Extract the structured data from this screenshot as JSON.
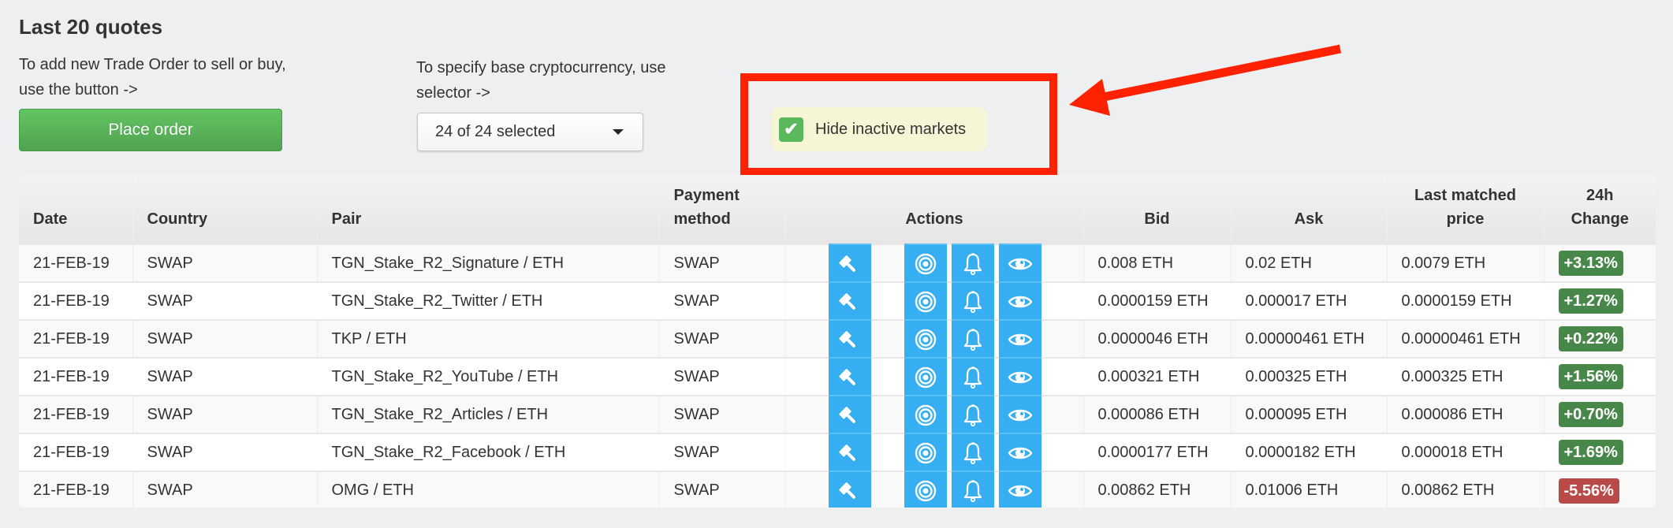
{
  "header": {
    "title": "Last 20 quotes",
    "order_hint": "To add new Trade Order to sell or buy, use the button ->",
    "selector_hint": "To specify base cryptocurrency, use selector ->"
  },
  "controls": {
    "place_order_label": "Place order",
    "base_currency_selector": {
      "value": "24 of 24 selected",
      "icon": "caret-down-icon"
    },
    "hide_inactive": {
      "label": "Hide inactive markets",
      "checked": true,
      "check_glyph": "✔"
    }
  },
  "annotation": {
    "color": "#ff2200",
    "shapes": [
      "highlight-box",
      "arrow"
    ]
  },
  "colors": {
    "action_button": "#36aef2",
    "badge_positive": "#47874a",
    "badge_negative": "#b94a48",
    "place_order": "#5cb85c",
    "checkbox": "#5cb85c",
    "hide_inactive_bg": "#f6f6d6"
  },
  "table": {
    "columns": [
      "Date",
      "Country",
      "Pair",
      "Payment method",
      "Actions",
      "Bid",
      "Ask",
      "Last matched price",
      "24h Change"
    ],
    "actions": [
      {
        "name": "bid-gavel",
        "icon": "gavel-icon"
      },
      {
        "name": "target",
        "icon": "bullseye-icon"
      },
      {
        "name": "alert",
        "icon": "bell-icon"
      },
      {
        "name": "watch",
        "icon": "eye-icon"
      }
    ],
    "rows": [
      {
        "date": "21-FEB-19",
        "country": "SWAP",
        "pair": "TGN_Stake_R2_Signature / ETH",
        "payment": "SWAP",
        "bid": "0.008 ETH",
        "ask": "0.02 ETH",
        "last": "0.0079 ETH",
        "change": "+3.13%",
        "direction": "up"
      },
      {
        "date": "21-FEB-19",
        "country": "SWAP",
        "pair": "TGN_Stake_R2_Twitter / ETH",
        "payment": "SWAP",
        "bid": "0.0000159 ETH",
        "ask": "0.000017 ETH",
        "last": "0.0000159 ETH",
        "change": "+1.27%",
        "direction": "up"
      },
      {
        "date": "21-FEB-19",
        "country": "SWAP",
        "pair": "TKP / ETH",
        "payment": "SWAP",
        "bid": "0.0000046 ETH",
        "ask": "0.00000461 ETH",
        "last": "0.00000461 ETH",
        "change": "+0.22%",
        "direction": "up"
      },
      {
        "date": "21-FEB-19",
        "country": "SWAP",
        "pair": "TGN_Stake_R2_YouTube / ETH",
        "payment": "SWAP",
        "bid": "0.000321 ETH",
        "ask": "0.000325 ETH",
        "last": "0.000325 ETH",
        "change": "+1.56%",
        "direction": "up"
      },
      {
        "date": "21-FEB-19",
        "country": "SWAP",
        "pair": "TGN_Stake_R2_Articles / ETH",
        "payment": "SWAP",
        "bid": "0.000086 ETH",
        "ask": "0.000095 ETH",
        "last": "0.000086 ETH",
        "change": "+0.70%",
        "direction": "up"
      },
      {
        "date": "21-FEB-19",
        "country": "SWAP",
        "pair": "TGN_Stake_R2_Facebook / ETH",
        "payment": "SWAP",
        "bid": "0.0000177 ETH",
        "ask": "0.0000182 ETH",
        "last": "0.000018 ETH",
        "change": "+1.69%",
        "direction": "up"
      },
      {
        "date": "21-FEB-19",
        "country": "SWAP",
        "pair": "OMG / ETH",
        "payment": "SWAP",
        "bid": "0.00862 ETH",
        "ask": "0.01006 ETH",
        "last": "0.00862 ETH",
        "change": "-5.56%",
        "direction": "down"
      }
    ]
  }
}
